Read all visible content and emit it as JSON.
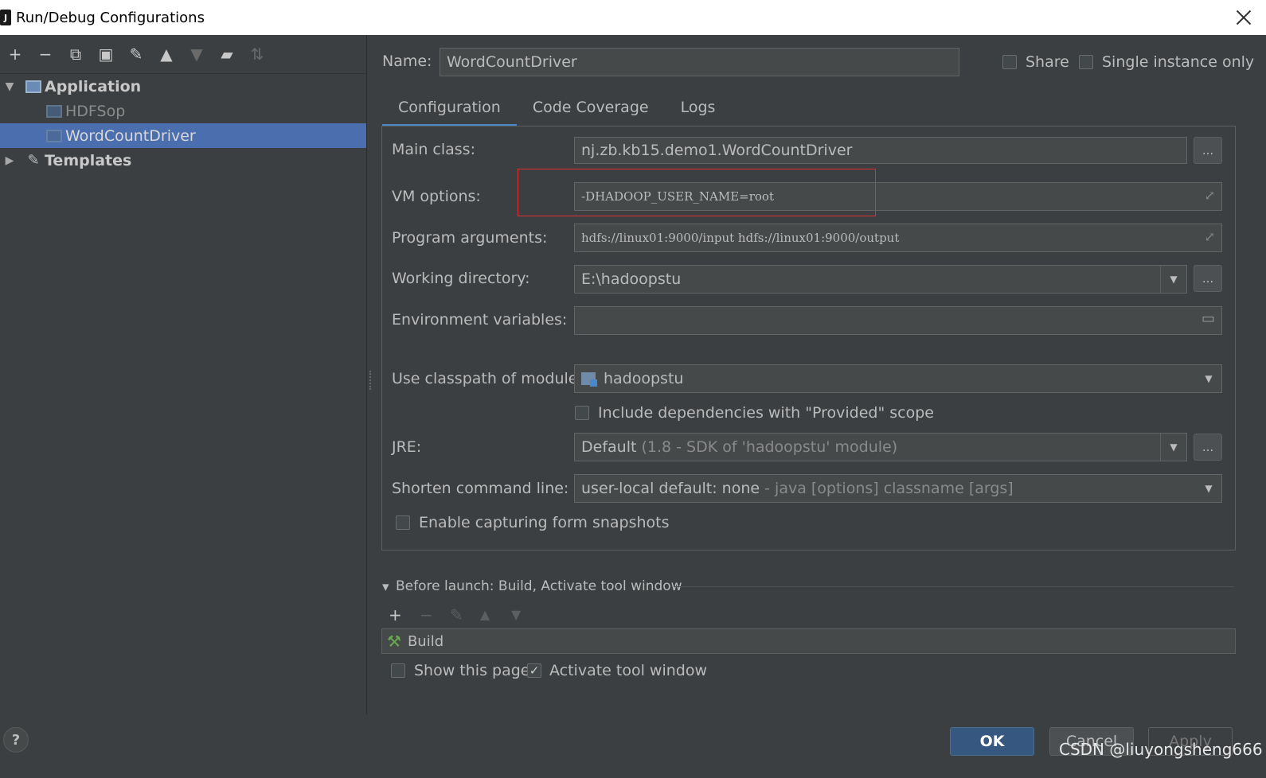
{
  "window": {
    "title": "Run/Debug Configurations",
    "icon": "intellij-icon"
  },
  "left_toolbar": {
    "icons": [
      "add-icon",
      "remove-icon",
      "copy-icon",
      "save-icon",
      "wrench-icon",
      "move-up-icon",
      "move-down-icon",
      "new-folder-icon",
      "sort-icon"
    ],
    "glyphs": [
      "+",
      "−",
      "⧉",
      "▣",
      "🔧",
      "▲",
      "▼",
      "📁",
      "↓ᶻ"
    ]
  },
  "tree": {
    "application": "Application",
    "items": [
      "HDFSop",
      "WordCountDriver"
    ],
    "templates": "Templates"
  },
  "form": {
    "name_label": "Name:",
    "name_value": "WordCountDriver",
    "share_label": "Share",
    "single_instance_label": "Single instance only",
    "tabs": [
      "Configuration",
      "Code Coverage",
      "Logs"
    ],
    "main_class_label": "Main class:",
    "main_class_value": "nj.zb.kb15.demo1.WordCountDriver",
    "vm_options_label": "VM options:",
    "vm_options_value": "-DHADOOP_USER_NAME=root",
    "program_args_label": "Program arguments:",
    "program_args_value": "hdfs://linux01:9000/input hdfs://linux01:9000/output",
    "working_dir_label": "Working directory:",
    "working_dir_value": "E:\\hadoopstu",
    "env_vars_label": "Environment variables:",
    "env_vars_value": "",
    "classpath_label": "Use classpath of module:",
    "classpath_value": "hadoopstu",
    "include_deps_label": "Include dependencies with \"Provided\" scope",
    "jre_label": "JRE:",
    "jre_value": "Default",
    "jre_hint": "(1.8 - SDK of 'hadoopstu' module)",
    "shorten_label": "Shorten command line:",
    "shorten_value": "user-local default: none",
    "shorten_hint": "- java [options] classname [args]",
    "snapshots_label": "Enable capturing form snapshots",
    "ellipsis": "..."
  },
  "before_launch": {
    "title": "Before launch: Build, Activate tool window",
    "item": "Build",
    "show_page_label": "Show this page",
    "activate_label": "Activate tool window",
    "activate_checked": true
  },
  "buttons": {
    "ok": "OK",
    "cancel": "Cancel",
    "apply": "Apply"
  },
  "watermark": "CSDN @liuyongsheng666",
  "colors": {
    "background": "#3c3f41",
    "selection": "#4b6eaf",
    "ok": "#365880",
    "highlight": "#e03030"
  }
}
